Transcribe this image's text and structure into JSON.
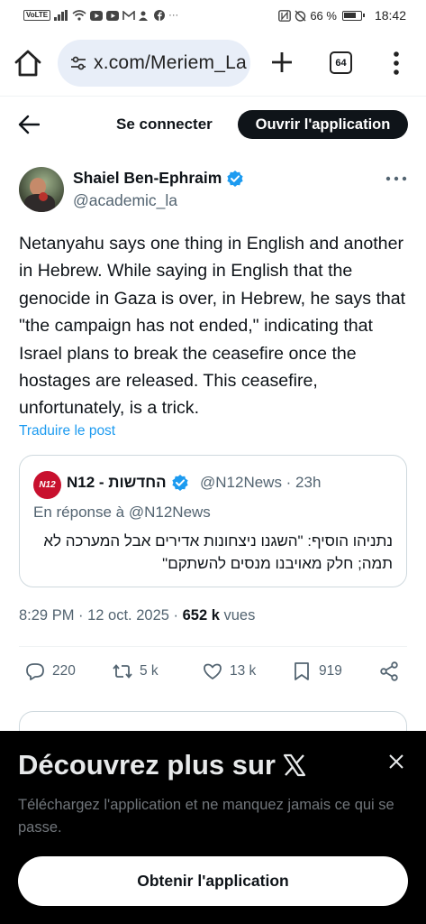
{
  "status_bar": {
    "volte": "VoLTE",
    "battery": "66 %",
    "time": "18:42"
  },
  "browser": {
    "url": "x.com/Meriem_La",
    "tab_count": "64",
    "icons": [
      "home-icon",
      "site-settings-icon",
      "plus-icon",
      "tabs-icon",
      "more-vert-icon"
    ]
  },
  "header": {
    "login": "Se connecter",
    "open_app": "Ouvrir l'application"
  },
  "tweet": {
    "author_name": "Shaiel Ben-Ephraim",
    "author_handle": "@academic_la",
    "text": "Netanyahu says one thing in English and another in Hebrew. While saying in English that the genocide in Gaza is over, in Hebrew, he says that \"the campaign has not ended,\" indicating that Israel plans to break the ceasefire once the hostages are released. This ceasefire, unfortunately, is a trick.",
    "translate": "Traduire le post",
    "time": "8:29 PM · 12 oct. 2025 · ",
    "views_count": "652 k",
    "views_label": " vues"
  },
  "quote": {
    "avatar_text": "N12",
    "name": "N12 - החדשות",
    "handle_time": "@N12News · 23h",
    "reply_to": "En réponse à @N12News",
    "text": "נתניהו הוסיף: \"השגנו ניצחונות אדירים אבל המערכה לא תמה; חלק מאויבנו מנסים להשתקם\""
  },
  "actions": {
    "replies": "220",
    "reposts": "5 k",
    "likes": "13 k",
    "bookmarks": "919"
  },
  "sheet": {
    "title": "Découvrez plus sur",
    "subtitle": "Téléchargez l'application et ne manquez jamais ce qui se passe.",
    "button": "Obtenir l'application"
  },
  "colors": {
    "accent": "#1d9bf0",
    "text": "#0f1419",
    "muted": "#536471",
    "sheet_bg": "#000000",
    "url_bg": "#e8eef8"
  }
}
